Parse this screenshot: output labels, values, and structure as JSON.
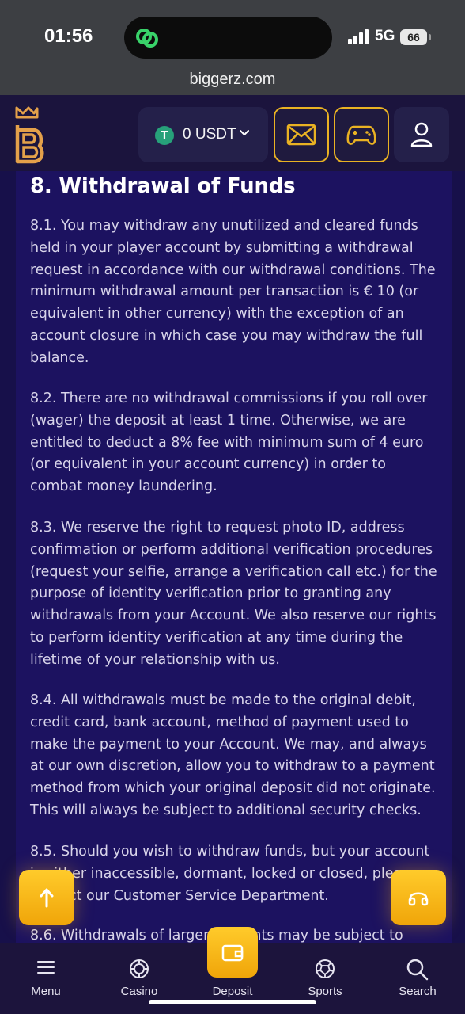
{
  "status_bar": {
    "time": "01:56",
    "network": "5G",
    "battery": "66"
  },
  "browser": {
    "url": "biggerz.com"
  },
  "header": {
    "wallet_label": "0 USDT",
    "icons": [
      "logo-b",
      "tether-icon",
      "chevron-down-icon",
      "mail-icon",
      "gamepad-icon",
      "user-icon"
    ],
    "accent": "#e9b223"
  },
  "content": {
    "title": "8. Withdrawal of Funds",
    "paragraphs": [
      "8.1. You may withdraw any unutilized and cleared funds held in your player account by submitting a withdrawal request in accordance with our withdrawal conditions. The minimum withdrawal amount per transaction is € 10 (or equivalent in other currency) with the exception of an account closure in which case you may withdraw the full balance.",
      "8.2. There are no withdrawal commissions if you roll over (wager) the deposit at least 1 time. Otherwise, we are entitled to deduct a 8% fee with minimum sum of 4 euro (or equivalent in your account currency) in order to combat money laundering.",
      "8.3. We reserve the right to request photo ID, address confirmation or perform additional verification procedures (request your selfie, arrange a verification call etc.) for the purpose of identity verification prior to granting any withdrawals from your Account. We also reserve our rights to perform identity verification at any time during the lifetime of your relationship with us.",
      "8.4. All withdrawals must be made to the original debit, credit card, bank account, method of payment used to make the payment to your Account. We may, and always at our own discretion, allow you to withdraw to a payment method from which your original deposit did not originate. This will always be subject to additional security checks.",
      "8.5. Should you wish to withdraw funds, but your account is either inaccessible, dormant, locked or closed, please contact our Customer Service Department.",
      "8.6. Withdrawals of larger amounts may be subject to"
    ]
  },
  "bottom_nav": {
    "items": [
      {
        "label": "Menu",
        "icon": "hamburger-icon"
      },
      {
        "label": "Casino",
        "icon": "chip-icon"
      },
      {
        "label": "Deposit",
        "icon": "wallet-icon"
      },
      {
        "label": "Sports",
        "icon": "ball-icon"
      },
      {
        "label": "Search",
        "icon": "search-icon"
      }
    ]
  },
  "floating": {
    "left_icon": "arrow-up-icon",
    "right_icon": "headset-icon"
  }
}
